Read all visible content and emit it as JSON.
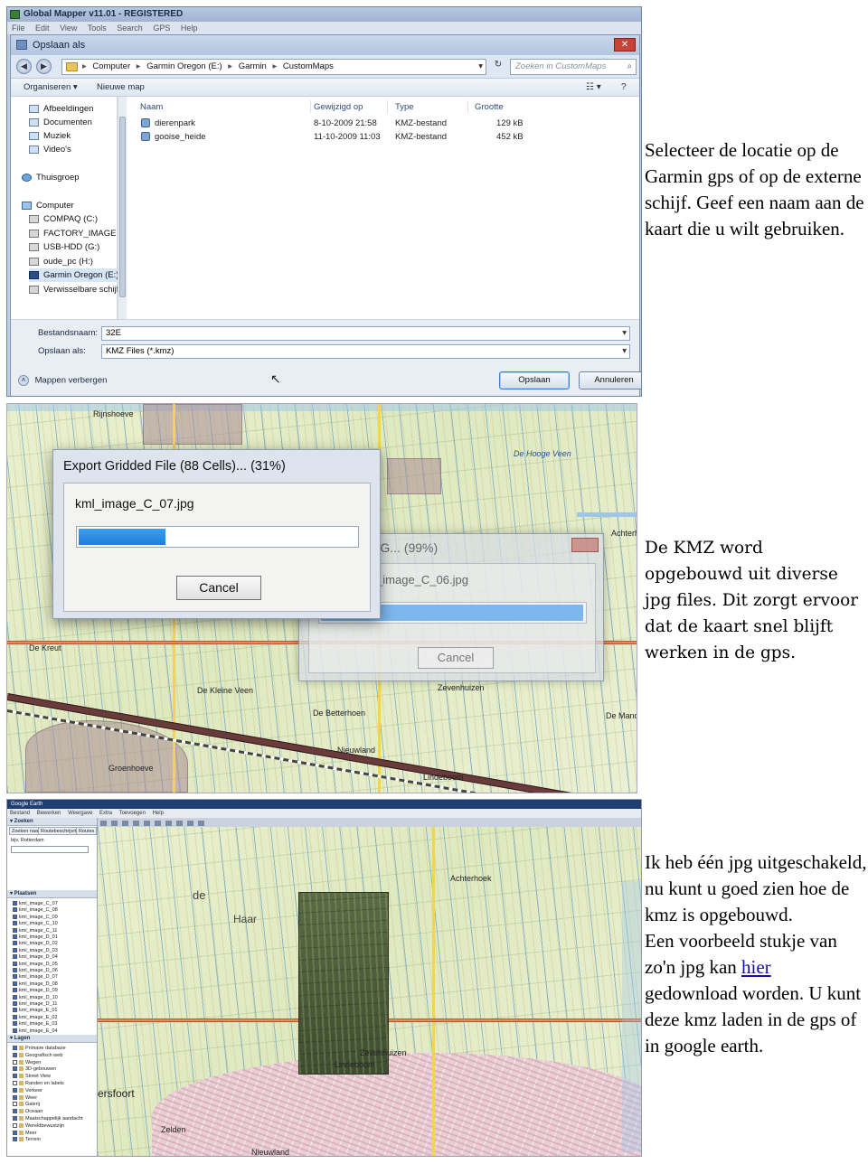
{
  "captions": {
    "step1": "Selecteer de locatie op de Garmin gps of op de externe schijf. Geef een naam aan de kaart die u wilt gebruiken.",
    "step2": "De KMZ word opgebouwd uit diverse jpg files. Dit zorgt ervoor dat de kaart snel blijft werken in de gps.",
    "step3_line1": "Ik heb één jpg uitgeschakeld, nu kunt u goed zien hoe de kmz is opgebouwd.",
    "step3_pre_link": "Een voorbeeld stukje van zo'n jpg kan ",
    "step3_link": "hier",
    "step3_post_link": " gedownload worden. U kunt deze kmz laden in de gps of in google earth."
  },
  "save_dialog": {
    "app_title": "Global Mapper v11.01 - REGISTERED",
    "app_menu": [
      "File",
      "Edit",
      "View",
      "Tools",
      "Search",
      "GPS",
      "Help"
    ],
    "title": "Opslaan als",
    "close_glyph": "✕",
    "back_glyph": "◀",
    "forward_glyph": "▶",
    "refresh_glyph": "↻",
    "breadcrumb": [
      "Computer",
      "Garmin Oregon (E:)",
      "Garmin",
      "CustomMaps"
    ],
    "breadcrumb_sep": "▸",
    "search_placeholder": "Zoeken in CustomMaps",
    "search_glyph": "⌕",
    "toolbar": {
      "organize": "Organiseren ▾",
      "new_folder": "Nieuwe map",
      "views_glyph": "☷ ▾",
      "help_glyph": "?"
    },
    "nav_items": [
      {
        "label": "Afbeeldingen",
        "icon": "folder-icon"
      },
      {
        "label": "Documenten",
        "icon": "folder-icon"
      },
      {
        "label": "Muziek",
        "icon": "folder-icon"
      },
      {
        "label": "Video's",
        "icon": "folder-icon"
      },
      {
        "label": "Thuisgroep",
        "icon": "homegroup-icon"
      },
      {
        "label": "Computer",
        "icon": "computer-icon"
      },
      {
        "label": "COMPAQ (C:)",
        "icon": "drive-icon"
      },
      {
        "label": "FACTORY_IMAGE",
        "icon": "drive-icon"
      },
      {
        "label": "USB-HDD (G:)",
        "icon": "drive-icon"
      },
      {
        "label": "oude_pc (H:)",
        "icon": "drive-icon"
      },
      {
        "label": "Garmin Oregon (E:)",
        "icon": "gps-drive-icon"
      },
      {
        "label": "Verwisselbare schijf",
        "icon": "drive-icon"
      }
    ],
    "columns": [
      "Naam",
      "Gewijzigd op",
      "Type",
      "Grootte"
    ],
    "files": [
      {
        "name": "dierenpark",
        "modified": "8-10-2009 21:58",
        "type": "KMZ-bestand",
        "size": "129 kB"
      },
      {
        "name": "gooise_heide",
        "modified": "11-10-2009 11:03",
        "type": "KMZ-bestand",
        "size": "452 kB"
      }
    ],
    "filename_label": "Bestandsnaam:",
    "filename_value": "32E",
    "savetype_label": "Opslaan als:",
    "savetype_value": "KMZ Files (*.kmz)",
    "hide_folders": "Mappen verbergen",
    "hide_glyph": "˄",
    "dropdown_glyph": "▾",
    "save_button": "Opslaan",
    "cancel_button": "Annuleren"
  },
  "export_progress": {
    "title": "Export Gridded File (88 Cells)... (31%)",
    "file": "kml_image_C_07.jpg",
    "progress": 0.31,
    "cancel": "Cancel"
  },
  "jpg_progress": {
    "title": "Exporting JPG... (99%)",
    "file": "Writing kml_image_C_06.jpg",
    "progress": 0.99,
    "cancel": "Cancel"
  },
  "map_labels": {
    "p2": [
      "De Kreut",
      "De Kleine Veen",
      "De Betterhoen",
      "Zevenhuizen",
      "Achterhoek",
      "Nieuwland",
      "Groenhoeve",
      "De Mande",
      "De Hooge Veen",
      "Lindeboom",
      "Rijnshoeve"
    ],
    "p3": [
      "Achterhoek",
      "Haar",
      "de",
      "Zevenhuizen",
      "Lindeboom",
      "ersfoort",
      "Zelden",
      "Nieuwland"
    ]
  },
  "google_earth": {
    "title": "Google Earth",
    "menu": [
      "Bestand",
      "Bewerken",
      "Weergave",
      "Extra",
      "Toevoegen",
      "Help"
    ],
    "search_header": "▾ Zoeken",
    "tabs": [
      "Zoeken naar",
      "Routebeschrijvingen",
      "Routes"
    ],
    "search_field_label": "bijv. Rotterdam",
    "places_header": "▾ Plaatsen",
    "places_items": [
      "kml_image_C_07",
      "kml_image_C_08",
      "kml_image_C_09",
      "kml_image_C_10",
      "kml_image_C_11",
      "kml_image_D_01",
      "kml_image_D_02",
      "kml_image_D_03",
      "kml_image_D_04",
      "kml_image_D_05",
      "kml_image_D_06",
      "kml_image_D_07",
      "kml_image_D_08",
      "kml_image_D_09",
      "kml_image_D_10",
      "kml_image_D_11",
      "kml_image_E_01",
      "kml_image_E_02",
      "kml_image_E_03",
      "kml_image_E_04"
    ],
    "layers_header": "▾ Lagen",
    "layers_items": [
      "Primaire database",
      "Geografisch web",
      "Wegen",
      "3D-gebouwen",
      "Street View",
      "Randen en labels",
      "Verkeer",
      "Weer",
      "Galerij",
      "Oceaan",
      "Maatschappelijk aandacht",
      "Wereldbewustzijn",
      "Meer",
      "Terrein"
    ]
  }
}
